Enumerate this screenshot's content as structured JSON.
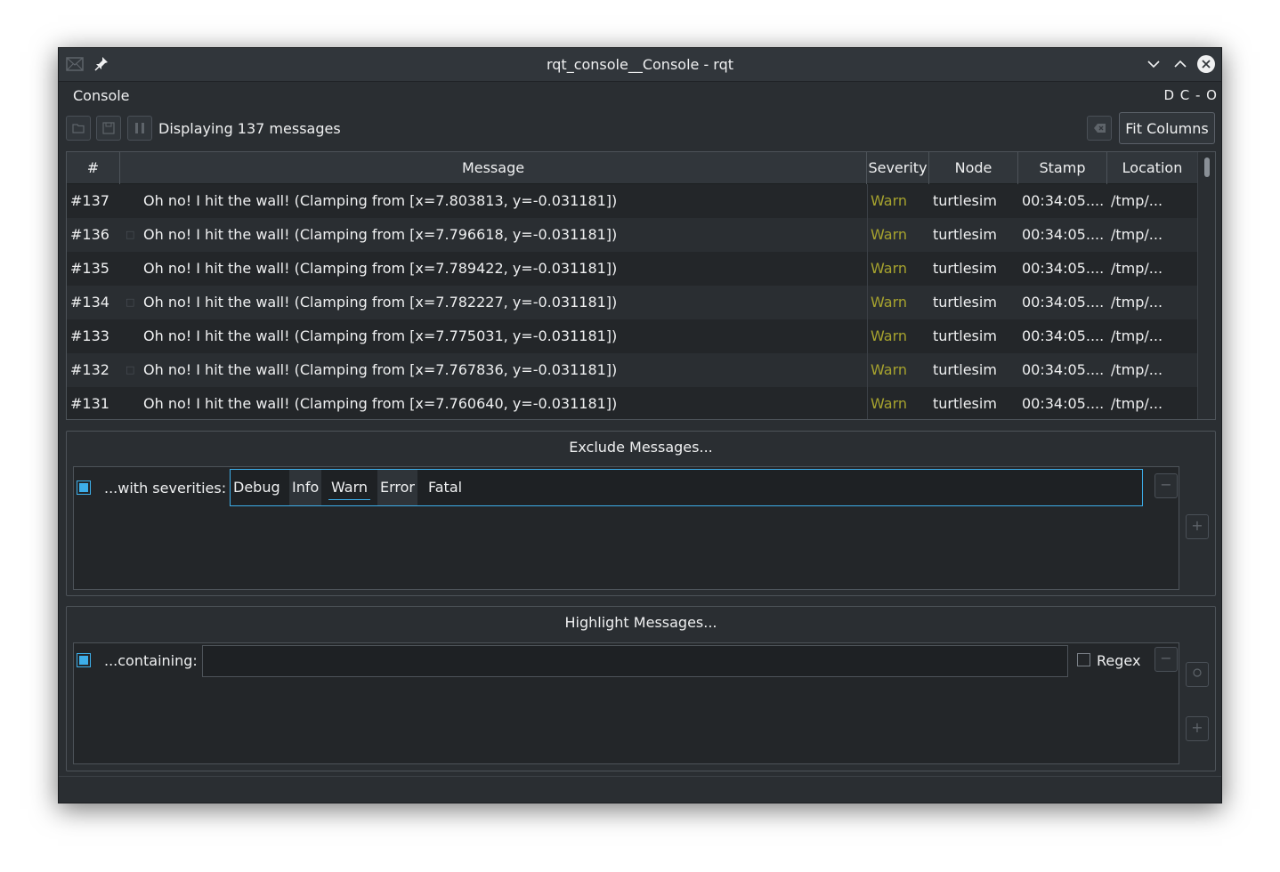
{
  "window": {
    "title": "rqt_console__Console - rqt"
  },
  "dock": {
    "title": "Console",
    "buttons_label": "D C    - O"
  },
  "toolbar": {
    "status": "Displaying 137 messages",
    "fit_columns_label": "Fit Columns"
  },
  "table": {
    "headers": [
      "#",
      "Message",
      "Severity",
      "Node",
      "Stamp",
      "Location"
    ],
    "rows": [
      {
        "num": "#137",
        "message": "Oh no! I hit the wall! (Clamping from [x=7.803813, y=-0.031181])",
        "severity": "Warn",
        "node": "turtlesim",
        "stamp": "00:34:05....",
        "location": "/tmp/..."
      },
      {
        "num": "#136",
        "message": "Oh no! I hit the wall! (Clamping from [x=7.796618, y=-0.031181])",
        "severity": "Warn",
        "node": "turtlesim",
        "stamp": "00:34:05....",
        "location": "/tmp/..."
      },
      {
        "num": "#135",
        "message": "Oh no! I hit the wall! (Clamping from [x=7.789422, y=-0.031181])",
        "severity": "Warn",
        "node": "turtlesim",
        "stamp": "00:34:05....",
        "location": "/tmp/..."
      },
      {
        "num": "#134",
        "message": "Oh no! I hit the wall! (Clamping from [x=7.782227, y=-0.031181])",
        "severity": "Warn",
        "node": "turtlesim",
        "stamp": "00:34:05....",
        "location": "/tmp/..."
      },
      {
        "num": "#133",
        "message": "Oh no! I hit the wall! (Clamping from [x=7.775031, y=-0.031181])",
        "severity": "Warn",
        "node": "turtlesim",
        "stamp": "00:34:05....",
        "location": "/tmp/..."
      },
      {
        "num": "#132",
        "message": "Oh no! I hit the wall! (Clamping from [x=7.767836, y=-0.031181])",
        "severity": "Warn",
        "node": "turtlesim",
        "stamp": "00:34:05....",
        "location": "/tmp/..."
      },
      {
        "num": "#131",
        "message": "Oh no! I hit the wall! (Clamping from [x=7.760640, y=-0.031181])",
        "severity": "Warn",
        "node": "turtlesim",
        "stamp": "00:34:05....",
        "location": "/tmp/..."
      }
    ]
  },
  "exclude": {
    "title": "Exclude Messages...",
    "severities_label": "...with severities:",
    "severities": [
      "Debug",
      "Info",
      "Warn",
      "Error",
      "Fatal"
    ],
    "remove_label": "−",
    "add_label": "+"
  },
  "highlight": {
    "title": "Highlight Messages...",
    "containing_label": "...containing:",
    "containing_value": "",
    "regex_label": "Regex",
    "remove_label": "−",
    "add_label": "+"
  },
  "colors": {
    "warn": "#a6a22e",
    "accent": "#3daee9"
  }
}
